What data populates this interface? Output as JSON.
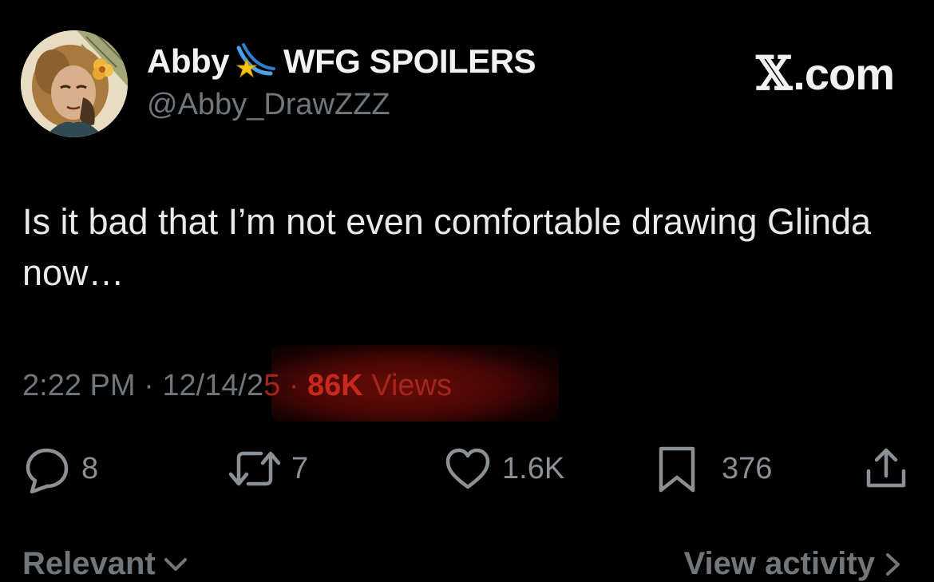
{
  "author": {
    "display_name": "Abby",
    "display_suffix": "WFG SPOILERS",
    "handle": "@Abby_DrawZZZ",
    "name_emoji_icon": "comet-icon"
  },
  "brand": {
    "x_glyph": "𝕏",
    "label": ".com"
  },
  "tweet": {
    "text": "Is it bad that I’m not even comfortable drawing Glinda now…"
  },
  "meta": {
    "time": "2:22 PM",
    "date_visible": "12/14/2",
    "date_tail": "5",
    "views_count": "86K",
    "views_label": "Views",
    "separator": "·"
  },
  "actions": {
    "replies": "8",
    "reposts": "7",
    "likes": "1.6K",
    "bookmarks": "376"
  },
  "footer": {
    "sort_label": "Relevant",
    "view_activity_label": "View activity"
  },
  "colors": {
    "background": "#000000",
    "text": "#e7e9ea",
    "secondary": "#71767b",
    "highlight": "#c8281e"
  }
}
